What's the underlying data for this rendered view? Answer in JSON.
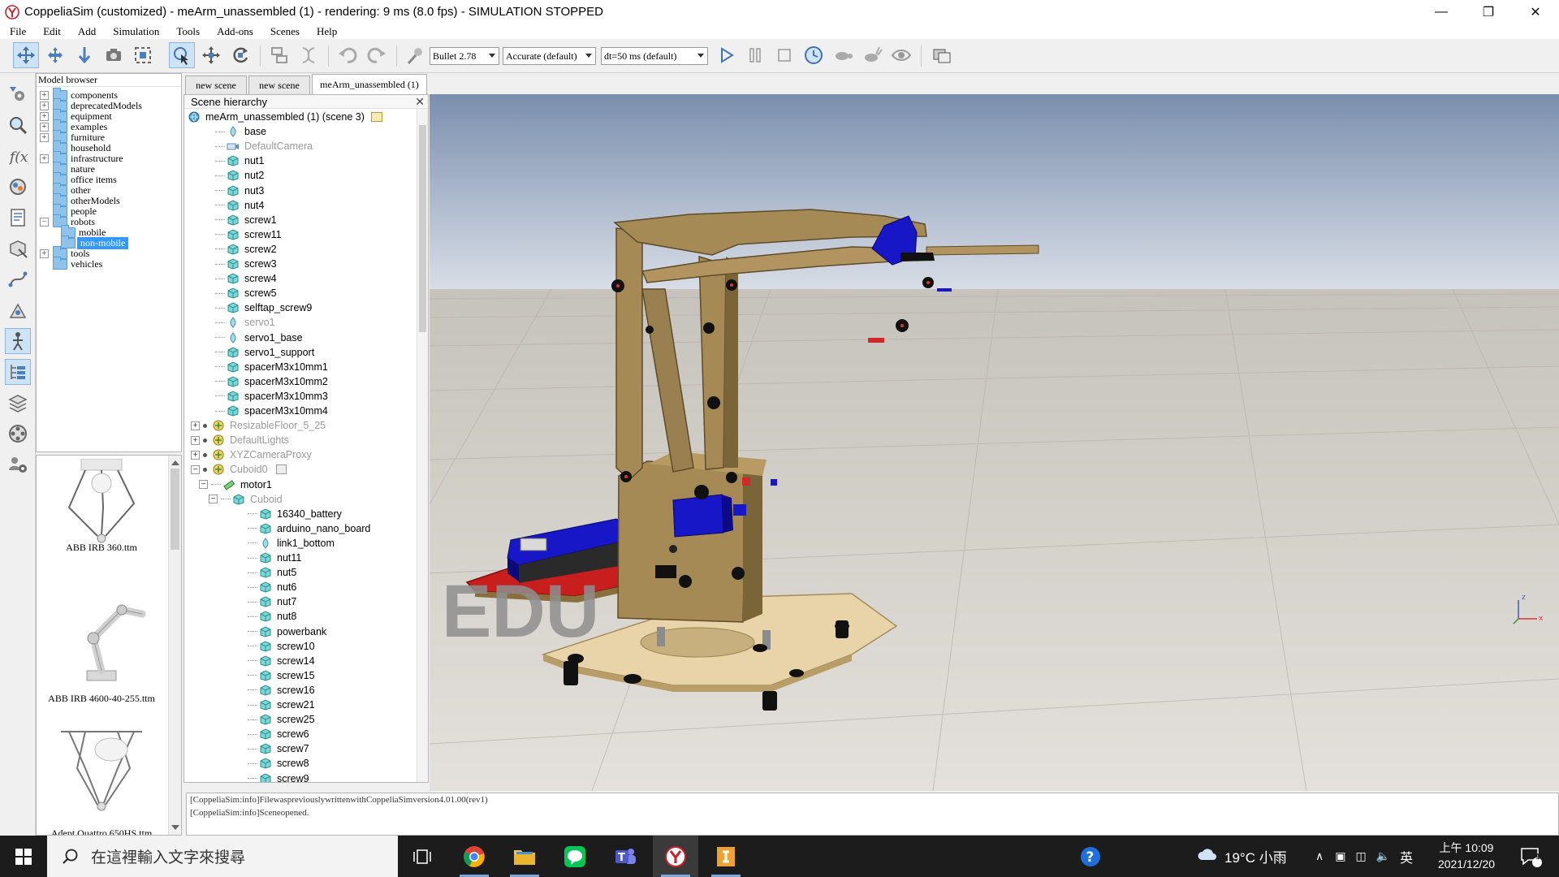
{
  "window": {
    "title": "CoppeliaSim (customized) - meArm_unassembled (1) - rendering: 9 ms (8.0 fps) - SIMULATION STOPPED",
    "minimize": "—",
    "maximize": "❐",
    "close": "✕"
  },
  "menu": [
    "File",
    "Edit",
    "Add",
    "Simulation",
    "Tools",
    "Add-ons",
    "Scenes",
    "Help"
  ],
  "toolbar": {
    "engine": "Bullet 2.78",
    "accuracy": "Accurate (default)",
    "timestep": "dt=50 ms (default)"
  },
  "model_browser": {
    "title": "Model browser",
    "items": [
      {
        "label": "components",
        "expandable": true
      },
      {
        "label": "deprecatedModels",
        "expandable": true
      },
      {
        "label": "equipment",
        "expandable": true
      },
      {
        "label": "examples",
        "expandable": true
      },
      {
        "label": "furniture",
        "expandable": true
      },
      {
        "label": "household",
        "expandable": false
      },
      {
        "label": "infrastructure",
        "expandable": true
      },
      {
        "label": "nature",
        "expandable": false
      },
      {
        "label": "office items",
        "expandable": false
      },
      {
        "label": "other",
        "expandable": false
      },
      {
        "label": "otherModels",
        "expandable": false
      },
      {
        "label": "people",
        "expandable": false
      },
      {
        "label": "robots",
        "expandable": true,
        "expanded": true
      },
      {
        "label": "mobile",
        "expandable": false,
        "child": true
      },
      {
        "label": "non-mobile",
        "expandable": false,
        "child": true,
        "selected": true
      },
      {
        "label": "tools",
        "expandable": true
      },
      {
        "label": "vehicles",
        "expandable": false
      }
    ]
  },
  "thumbnails": [
    {
      "caption": "ABB IRB 360.ttm"
    },
    {
      "caption": "ABB IRB 4600-40-255.ttm"
    },
    {
      "caption": "Adept Quattro 650HS.ttm"
    }
  ],
  "tabs": [
    "new scene",
    "new scene",
    "meArm_unassembled (1)"
  ],
  "scene_hierarchy": {
    "title": "Scene hierarchy",
    "close": "✕",
    "root": "meArm_unassembled (1) (scene 3)",
    "items": [
      {
        "label": "base",
        "icon": "dummy-icon",
        "gray": false,
        "level": 1
      },
      {
        "label": "DefaultCamera",
        "icon": "camera-icon",
        "gray": true,
        "level": 1
      },
      {
        "label": "nut1",
        "icon": "shape-icon",
        "gray": false,
        "level": 1
      },
      {
        "label": "nut2",
        "icon": "shape-icon",
        "gray": false,
        "level": 1
      },
      {
        "label": "nut3",
        "icon": "shape-icon",
        "gray": false,
        "level": 1
      },
      {
        "label": "nut4",
        "icon": "shape-icon",
        "gray": false,
        "level": 1
      },
      {
        "label": "screw1",
        "icon": "shape-icon",
        "gray": false,
        "level": 1
      },
      {
        "label": "screw11",
        "icon": "shape-icon",
        "gray": false,
        "level": 1
      },
      {
        "label": "screw2",
        "icon": "shape-icon",
        "gray": false,
        "level": 1
      },
      {
        "label": "screw3",
        "icon": "shape-icon",
        "gray": false,
        "level": 1
      },
      {
        "label": "screw4",
        "icon": "shape-icon",
        "gray": false,
        "level": 1
      },
      {
        "label": "screw5",
        "icon": "shape-icon",
        "gray": false,
        "level": 1
      },
      {
        "label": "selftap_screw9",
        "icon": "shape-icon",
        "gray": false,
        "level": 1
      },
      {
        "label": "servo1",
        "icon": "dummy-icon",
        "gray": true,
        "level": 1
      },
      {
        "label": "servo1_base",
        "icon": "dummy-icon",
        "gray": false,
        "level": 1
      },
      {
        "label": "servo1_support",
        "icon": "shape-icon",
        "gray": false,
        "level": 1
      },
      {
        "label": "spacerM3x10mm1",
        "icon": "shape-icon",
        "gray": false,
        "level": 1
      },
      {
        "label": "spacerM3x10mm2",
        "icon": "shape-icon",
        "gray": false,
        "level": 1
      },
      {
        "label": "spacerM3x10mm3",
        "icon": "shape-icon",
        "gray": false,
        "level": 1
      },
      {
        "label": "spacerM3x10mm4",
        "icon": "shape-icon",
        "gray": false,
        "level": 1
      },
      {
        "label": "ResizableFloor_5_25",
        "icon": "model-icon",
        "gray": true,
        "level": 0,
        "expandable": true
      },
      {
        "label": "DefaultLights",
        "icon": "model-icon",
        "gray": true,
        "level": 0,
        "expandable": true
      },
      {
        "label": "XYZCameraProxy",
        "icon": "model-icon",
        "gray": true,
        "level": 0,
        "expandable": true
      },
      {
        "label": "Cuboid0",
        "icon": "model-icon",
        "gray": true,
        "level": 0,
        "expandable": true,
        "expanded": true
      },
      {
        "label": "motor1",
        "icon": "joint-icon",
        "gray": false,
        "level": 1,
        "expandable": true,
        "expanded": true
      },
      {
        "label": "Cuboid",
        "icon": "shape-icon",
        "gray": true,
        "level": 2,
        "expandable": true,
        "expanded": true
      },
      {
        "label": "16340_battery",
        "icon": "shape-icon",
        "gray": false,
        "level": 3
      },
      {
        "label": "arduino_nano_board",
        "icon": "shape-icon",
        "gray": false,
        "level": 3
      },
      {
        "label": "link1_bottom",
        "icon": "dummy-icon",
        "gray": false,
        "level": 3
      },
      {
        "label": "nut11",
        "icon": "shape-icon",
        "gray": false,
        "level": 3
      },
      {
        "label": "nut5",
        "icon": "shape-icon",
        "gray": false,
        "level": 3
      },
      {
        "label": "nut6",
        "icon": "shape-icon",
        "gray": false,
        "level": 3
      },
      {
        "label": "nut7",
        "icon": "shape-icon",
        "gray": false,
        "level": 3
      },
      {
        "label": "nut8",
        "icon": "shape-icon",
        "gray": false,
        "level": 3
      },
      {
        "label": "powerbank",
        "icon": "shape-icon",
        "gray": false,
        "level": 3
      },
      {
        "label": "screw10",
        "icon": "shape-icon",
        "gray": false,
        "level": 3
      },
      {
        "label": "screw14",
        "icon": "shape-icon",
        "gray": false,
        "level": 3
      },
      {
        "label": "screw15",
        "icon": "shape-icon",
        "gray": false,
        "level": 3
      },
      {
        "label": "screw16",
        "icon": "shape-icon",
        "gray": false,
        "level": 3
      },
      {
        "label": "screw21",
        "icon": "shape-icon",
        "gray": false,
        "level": 3
      },
      {
        "label": "screw25",
        "icon": "shape-icon",
        "gray": false,
        "level": 3
      },
      {
        "label": "screw6",
        "icon": "shape-icon",
        "gray": false,
        "level": 3
      },
      {
        "label": "screw7",
        "icon": "shape-icon",
        "gray": false,
        "level": 3
      },
      {
        "label": "screw8",
        "icon": "shape-icon",
        "gray": false,
        "level": 3
      },
      {
        "label": "screw9",
        "icon": "shape-icon",
        "gray": false,
        "level": 3
      }
    ]
  },
  "viewport": {
    "watermark": "EDU",
    "axis_z": "z",
    "axis_x": "x"
  },
  "console": {
    "lines": [
      "[CoppeliaSim:info]FilewaspreviouslywrittenwithCoppeliaSimversion4.01.00(rev1)",
      "[CoppeliaSim:info]Sceneopened."
    ]
  },
  "taskbar": {
    "search_placeholder": "在這裡輸入文字來搜尋",
    "weather": "19°C  小雨",
    "ime": "英",
    "time": "上午 10:09",
    "date": "2021/12/20",
    "notifications": "1"
  },
  "colors": {
    "wood": "#a58a55",
    "wood_light": "#e8d4a8",
    "servo_blue": "#1717c8",
    "board_red": "#c81e1e",
    "sky_top": "#7b8fae",
    "sky_bottom": "#d8dde6",
    "selection": "#3399ff"
  }
}
